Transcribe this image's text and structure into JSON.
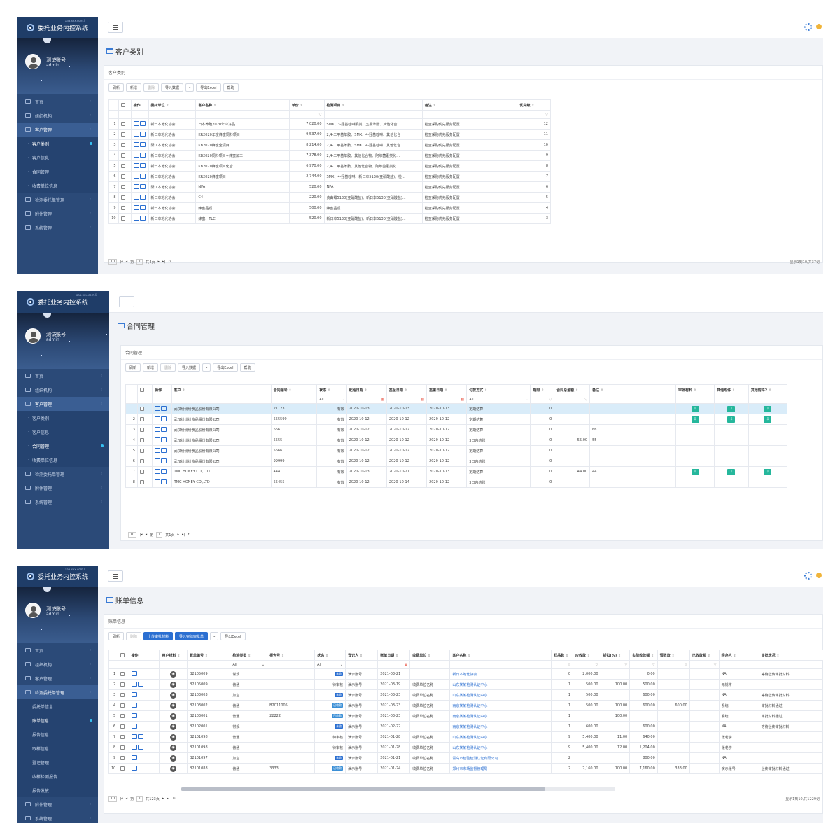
{
  "app": {
    "title": "委托业务内控系统",
    "subtitle": "aaa.xxx.com.li",
    "user_name": "测试账号",
    "user_role": "admin"
  },
  "panel1": {
    "page_title": "客户类别",
    "card_title": "客户类别",
    "menu": [
      {
        "label": "首页",
        "type": "top"
      },
      {
        "label": "组织机构",
        "type": "top"
      },
      {
        "label": "客户管理",
        "type": "open"
      },
      {
        "label": "客户类别",
        "type": "sub-active"
      },
      {
        "label": "客户信息",
        "type": "sub"
      },
      {
        "label": "合同管理",
        "type": "sub"
      },
      {
        "label": "收费单位信息",
        "type": "sub"
      },
      {
        "label": "检测委托单管理",
        "type": "top"
      },
      {
        "label": "附件管理",
        "type": "top"
      },
      {
        "label": "系统管理",
        "type": "top"
      }
    ],
    "toolbar": [
      "刷新",
      "新增",
      "删除",
      "导入数据",
      "导出Excel",
      "帮助"
    ],
    "headers": [
      "操作",
      "委托单位",
      "客户名称",
      "单价",
      "检测项目",
      "备注",
      "优先级"
    ],
    "rows": [
      [
        "1",
        "新日本地化协会",
        "日本养殖2020年冷冻品",
        "7,020.00",
        "SMX、3-羟基喹啉酮类、五氯苯酚、其他化合...",
        "检查采购优先服务配置",
        "12"
      ],
      [
        "2",
        "新日本地化协会",
        "KR2020年度蜂蜜饲料项目",
        "9,537.00",
        "2,4-二甲基苯胺、SMX、4-羟基喹啉、其他化合",
        "检查采购优先服务配置",
        "11"
      ],
      [
        "3",
        "阳江本地化协会",
        "KB2020蜂蜜全项目",
        "8,214.00",
        "2,4-二甲基苯胺、SMX、4-羟基喹啉、其他化合...",
        "检查采购优先服务配置",
        "10"
      ],
      [
        "4",
        "新日本地化协会",
        "KB2020饲料项目+蜂蜜加工",
        "7,378.00",
        "2,4-二甲基苯胺、其他化合物、阿维菌素类化...",
        "检查采购优先服务配置",
        "9"
      ],
      [
        "5",
        "新日本地化协会",
        "KB2020蜂蜜项目化合",
        "6,970.00",
        "2,4-二甲基苯胺、其他化合物、阿维菌素类化...",
        "检查采购优先服务配置",
        "8"
      ],
      [
        "6",
        "新日本地化协会",
        "KR2020蜂蜜项目",
        "2,744.00",
        "SMX、4-羟基喹啉、新日本5130(亚硝酸盐)、检...",
        "检查采购优先服务配置",
        "7"
      ],
      [
        "7",
        "阳江本地化协会",
        "NPA",
        "520.00",
        "NPA",
        "检查采购优先服务配置",
        "6"
      ],
      [
        "8",
        "新日本地化协会",
        "C4",
        "220.00",
        "黄曲霉5130(亚硝酸盐)、新日本5130(亚硝酸盐)...",
        "检查采购优先服务配置",
        "5"
      ],
      [
        "9",
        "新日本地化协会",
        "蜂蜜品质",
        "500.00",
        "蜂蜜品质",
        "检查采购优先服务配置",
        "4"
      ],
      [
        "10",
        "新日本地化协会",
        "蜂蜜、TLC",
        "520.00",
        "新日本5130(亚硝酸盐)、新日本5130(亚硝酸盐)...",
        "检查采购优先服务配置",
        "3"
      ]
    ],
    "pager": {
      "page_size": "10",
      "page": "1",
      "total_pages": "共4页",
      "page_prefix": "第",
      "range": "显示1到10,共37记"
    }
  },
  "panel2": {
    "page_title": "合同管理",
    "card_title": "合同管理",
    "menu": [
      {
        "label": "首页",
        "type": "top"
      },
      {
        "label": "组织机构",
        "type": "top"
      },
      {
        "label": "客户管理",
        "type": "open"
      },
      {
        "label": "客户类别",
        "type": "sub"
      },
      {
        "label": "客户信息",
        "type": "sub"
      },
      {
        "label": "合同管理",
        "type": "sub-active"
      },
      {
        "label": "收费单位信息",
        "type": "sub"
      },
      {
        "label": "检测委托单管理",
        "type": "top"
      },
      {
        "label": "附件管理",
        "type": "top"
      },
      {
        "label": "系统管理",
        "type": "top"
      }
    ],
    "toolbar": [
      "刷新",
      "新增",
      "删除",
      "导入数据",
      "导出Excel",
      "帮助"
    ],
    "headers": [
      "操作",
      "客户",
      "合同编号",
      "状态",
      "起始日期",
      "签至日期",
      "签署日期",
      "付款方式",
      "期限",
      "合同总金额",
      "备注",
      "审批材料",
      "其他附件",
      "其他附件2"
    ],
    "filter_all": "All",
    "rows": [
      [
        "1",
        "武汉纷纷纷食品股份有限公司",
        "21123",
        "有效",
        "2020-10-13",
        "2020-10-13",
        "2020-10-13",
        "定期结算",
        "0",
        "",
        "",
        "1",
        "1",
        "1"
      ],
      [
        "2",
        "武汉纷纷纷食品股份有限公司",
        "555599",
        "有效",
        "2020-10-12",
        "2020-10-12",
        "2020-10-12",
        "定期结算",
        "0",
        "",
        "",
        "1",
        "1",
        "1"
      ],
      [
        "3",
        "武汉纷纷纷食品股份有限公司",
        "666",
        "有效",
        "2020-10-12",
        "2020-10-12",
        "2020-10-12",
        "定期结算",
        "0",
        "",
        "66",
        "0",
        "0",
        "0"
      ],
      [
        "4",
        "武汉纷纷纷食品股份有限公司",
        "5555",
        "有效",
        "2020-10-12",
        "2020-10-12",
        "2020-10-12",
        "3日内结账",
        "0",
        "55.00",
        "55",
        "0",
        "0",
        "0"
      ],
      [
        "5",
        "武汉纷纷纷食品股份有限公司",
        "5666",
        "有效",
        "2020-10-12",
        "2020-10-12",
        "2020-10-12",
        "定期结算",
        "0",
        "",
        "",
        "0",
        "0",
        "0"
      ],
      [
        "6",
        "武汉纷纷纷食品股份有限公司",
        "99999",
        "有效",
        "2020-10-12",
        "2020-10-12",
        "2020-10-12",
        "3日内结账",
        "0",
        "",
        "",
        "0",
        "0",
        "0"
      ],
      [
        "7",
        "TMC HONEY CO.,LTD",
        "444",
        "有效",
        "2020-10-13",
        "2020-10-21",
        "2020-10-13",
        "定期结算",
        "0",
        "44.00",
        "44",
        "1",
        "1",
        "1"
      ],
      [
        "8",
        "TMC HONEY CO.,LTD",
        "55455",
        "有效",
        "2020-10-12",
        "2020-10-14",
        "2020-10-12",
        "3日内结账",
        "0",
        "",
        "",
        "0",
        "0",
        "0"
      ]
    ],
    "pager": {
      "page_size": "10",
      "page": "1",
      "total_pages": "共1页",
      "page_prefix": "第"
    }
  },
  "panel3": {
    "page_title": "账单信息",
    "card_title": "账单信息",
    "menu": [
      {
        "label": "首页",
        "type": "top"
      },
      {
        "label": "组织机构",
        "type": "top"
      },
      {
        "label": "客户管理",
        "type": "top"
      },
      {
        "label": "检测委托单管理",
        "type": "open"
      },
      {
        "label": "委托单信息",
        "type": "sub"
      },
      {
        "label": "账单信息",
        "type": "sub-active"
      },
      {
        "label": "报告信息",
        "type": "sub"
      },
      {
        "label": "取样信息",
        "type": "sub"
      },
      {
        "label": "登记管理",
        "type": "sub"
      },
      {
        "label": "收样检测报告",
        "type": "sub"
      },
      {
        "label": "报告发放",
        "type": "sub"
      },
      {
        "label": "附件管理",
        "type": "top"
      },
      {
        "label": "系统管理",
        "type": "top"
      }
    ],
    "toolbar": [
      "刷新",
      "删除",
      "上传审批材料",
      "导入完结审批单",
      "导出Excel"
    ],
    "headers": [
      "操作",
      "用户材料",
      "账单编号",
      "检验类型",
      "报告号",
      "状态",
      "登记人",
      "账单日期",
      "收费单位",
      "客户名称",
      "样品数",
      "应收款",
      "折扣(%)",
      "实际收款额",
      "预收款",
      "已收款额",
      "经办人",
      "审批状况"
    ],
    "filter_all": "All",
    "rows": [
      [
        "1",
        "B2105009",
        "常规",
        "",
        "未收",
        "演示账号",
        "2021-03-21",
        "",
        "新日本地化协会",
        "0",
        "2,000.00",
        "",
        "0.00",
        "",
        "",
        "NA",
        "等待上传审批材料"
      ],
      [
        "2",
        "B2105009",
        "普通",
        "",
        "待审核",
        "演示账号",
        "2021-03-19",
        "收费单位名称",
        "山东某某检测认证中心",
        "1",
        "500.00",
        "100.00",
        "500.00",
        "",
        "",
        "无锡市",
        ""
      ],
      [
        "3",
        "B2103003",
        "加急",
        "",
        "未收",
        "演示账号",
        "2021-03-23",
        "收费单位名称",
        "山东某某检测认证中心",
        "1",
        "500.00",
        "",
        "600.00",
        "",
        "",
        "NA",
        "等待上传审批材料"
      ],
      [
        "4",
        "B2103002",
        "普通",
        "B2011005",
        "已收款",
        "演示账号",
        "2021-03-23",
        "收费单位名称",
        "南京某某检测认证中心",
        "1",
        "500.00",
        "100.00",
        "600.00",
        "600.00",
        "",
        "系统",
        "审批材料通过"
      ],
      [
        "5",
        "B2103001",
        "普通",
        "22222",
        "已收款",
        "演示账号",
        "2021-03-23",
        "收费单位名称",
        "南京某某检测认证中心",
        "1",
        "",
        "100.00",
        "",
        "",
        "",
        "系统",
        "审批材料通过"
      ],
      [
        "6",
        "B2102001",
        "常规",
        "",
        "未收",
        "演示账号",
        "2021-02-22",
        "",
        "南京某某检测认证中心",
        "1",
        "600.00",
        "",
        "600.00",
        "",
        "",
        "NA",
        "等待上传审批材料"
      ],
      [
        "7",
        "B2101098",
        "普通",
        "",
        "待审核",
        "演示账号",
        "2021-01-28",
        "收费单位名称",
        "山东某某检测认证中心",
        "9",
        "5,400.00",
        "11.00",
        "640.00",
        "",
        "",
        "张老学",
        ""
      ],
      [
        "8",
        "B2101098",
        "普通",
        "",
        "待审核",
        "演示账号",
        "2021-01-28",
        "收费单位名称",
        "山东某某检测认证中心",
        "9",
        "5,400.00",
        "12.00",
        "1,204.00",
        "",
        "",
        "张老学",
        ""
      ],
      [
        "9",
        "B2101097",
        "加急",
        "",
        "未收",
        "演示账号",
        "2021-01-21",
        "收费单位名称",
        "青岛市检验检测认证有限公司",
        "2",
        "",
        "",
        "800.00",
        "",
        "",
        "NA",
        ""
      ],
      [
        "10",
        "B2101088",
        "普通",
        "3333",
        "已收款",
        "演示账号",
        "2021-01-24",
        "收费单位名称",
        "郑州市市场监督管理局",
        "2",
        "7,160.00",
        "100.00",
        "7,160.00",
        "333.00",
        "",
        "演示账号",
        "上传审批材料通过"
      ]
    ],
    "pager": {
      "page_size": "10",
      "page": "1",
      "total_pages": "共123页",
      "page_prefix": "第",
      "range": "显示1到10,共1229记"
    }
  },
  "colors": {
    "sidebar": "#2b4a78",
    "accent": "#2b6fd1",
    "green": "#25b79c",
    "highlight": "#d9ecf9"
  }
}
